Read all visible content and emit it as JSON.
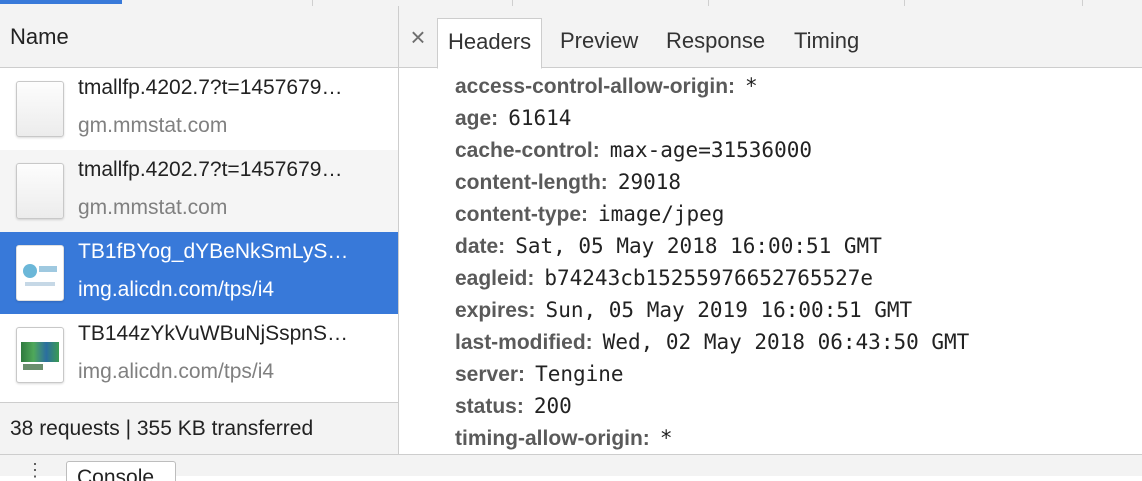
{
  "left": {
    "column_header": "Name",
    "requests": [
      {
        "name": "tmallfp.4202.7?t=1457679…",
        "host": "gm.mmstat.com",
        "icon": "blank-file-icon"
      },
      {
        "name": "tmallfp.4202.7?t=1457679…",
        "host": "gm.mmstat.com",
        "icon": "blank-file-icon"
      },
      {
        "name": "TB1fBYog_dYBeNkSmLyS…",
        "host": "img.alicdn.com/tps/i4",
        "icon": "image-thumbnail-icon"
      },
      {
        "name": "TB144zYkVuWBuNjSspnS…",
        "host": "img.alicdn.com/tps/i4",
        "icon": "image-thumbnail-icon"
      }
    ],
    "footer": "38 requests | 355 KB transferred"
  },
  "right": {
    "close_label": "×",
    "tabs": [
      "Headers",
      "Preview",
      "Response",
      "Timing"
    ],
    "active_tab": "Headers",
    "headers": [
      {
        "key": "access-control-allow-origin:",
        "value": "*"
      },
      {
        "key": "age:",
        "value": "61614"
      },
      {
        "key": "cache-control:",
        "value": "max-age=31536000"
      },
      {
        "key": "content-length:",
        "value": "29018"
      },
      {
        "key": "content-type:",
        "value": "image/jpeg"
      },
      {
        "key": "date:",
        "value": "Sat, 05 May 2018 16:00:51 GMT"
      },
      {
        "key": "eagleid:",
        "value": "b74243cb15255976652765527e"
      },
      {
        "key": "expires:",
        "value": "Sun, 05 May 2019 16:00:51 GMT"
      },
      {
        "key": "last-modified:",
        "value": "Wed, 02 May 2018 06:43:50 GMT"
      },
      {
        "key": "server:",
        "value": "Tengine"
      },
      {
        "key": "status:",
        "value": "200"
      },
      {
        "key": "timing-allow-origin:",
        "value": "*"
      }
    ]
  },
  "bottom": {
    "menu_glyph": "⋮",
    "console_button": "Console"
  },
  "colors": {
    "selected_row": "#3879d9",
    "panel_bg": "#f3f3f3",
    "border": "#cdcdcd"
  }
}
